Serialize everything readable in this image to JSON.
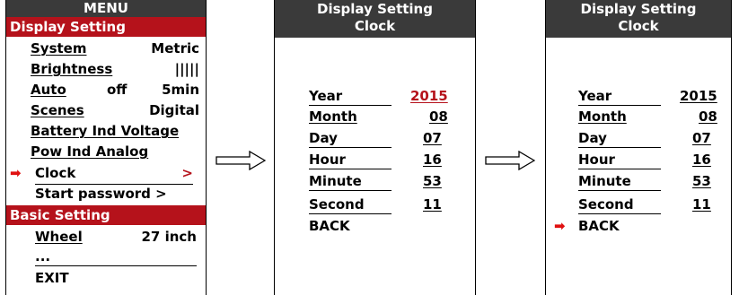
{
  "menu": {
    "title": "MENU",
    "section_display": "Display Setting",
    "items": [
      {
        "label": "System",
        "value": "Metric"
      },
      {
        "label": "Brightness",
        "value": "|||||"
      },
      {
        "label": "Auto",
        "mid": "off",
        "value": "5min"
      },
      {
        "label": "Scenes",
        "value": "Digital"
      },
      {
        "label": "Battery Ind Voltage"
      },
      {
        "label": "Pow Ind Analog"
      },
      {
        "label": "Clock",
        "value": ">"
      },
      {
        "label": "Start password >"
      }
    ],
    "section_basic": "Basic Setting",
    "basic_items": [
      {
        "label": "Wheel",
        "value": "27 inch"
      },
      {
        "label": "..."
      },
      {
        "label": "EXIT"
      }
    ]
  },
  "clock_panel_1": {
    "title_line1": "Display Setting",
    "title_line2": "Clock",
    "fields": [
      {
        "label": "Year",
        "value": "2015"
      },
      {
        "label": "Month",
        "value": "08"
      },
      {
        "label": "Day",
        "value": "07"
      },
      {
        "label": "Hour",
        "value": "16"
      },
      {
        "label": "Minute",
        "value": "53"
      },
      {
        "label": "Second",
        "value": "11"
      }
    ],
    "back": "BACK"
  },
  "clock_panel_2": {
    "title_line1": "Display Setting",
    "title_line2": "Clock",
    "fields": [
      {
        "label": "Year",
        "value": "2015"
      },
      {
        "label": "Month",
        "value": "08"
      },
      {
        "label": "Day",
        "value": "07"
      },
      {
        "label": "Hour",
        "value": "16"
      },
      {
        "label": "Minute",
        "value": "53"
      },
      {
        "label": "Second",
        "value": "11"
      }
    ],
    "back": "BACK"
  },
  "colors": {
    "accent": "#b5121b",
    "header": "#3a3a3a",
    "pointer": "#e01010"
  },
  "icons": {
    "pointer": "red-arrow-icon",
    "flow": "outline-arrow-icon"
  }
}
